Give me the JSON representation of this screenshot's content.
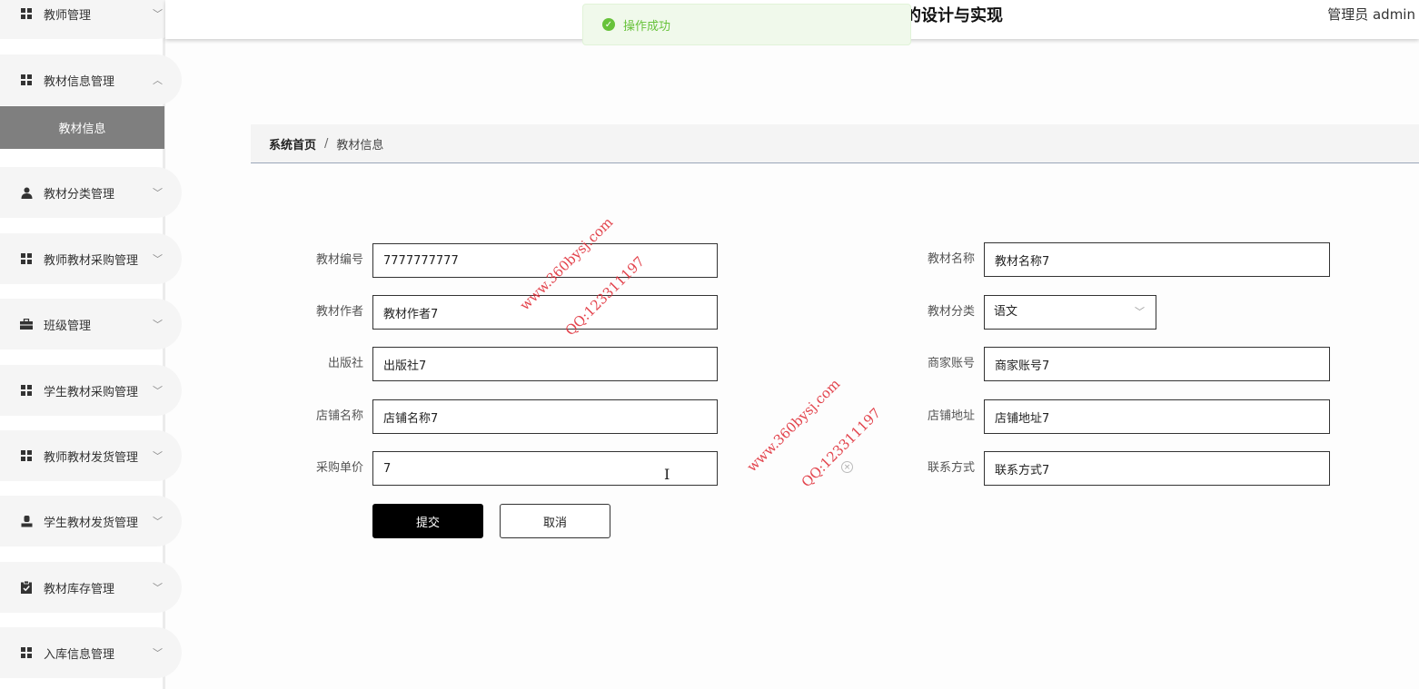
{
  "sidebar": {
    "items": [
      {
        "label": "教师管理",
        "icon": "grid-icon",
        "chevron": "﹀"
      },
      {
        "label": "教材信息管理",
        "icon": "grid-icon",
        "chevron": "︿"
      },
      {
        "label": "教材分类管理",
        "icon": "user-icon",
        "chevron": "﹀"
      },
      {
        "label": "教师教材采购管理",
        "icon": "grid-icon",
        "chevron": "﹀"
      },
      {
        "label": "班级管理",
        "icon": "briefcase-icon",
        "chevron": "﹀"
      },
      {
        "label": "学生教材采购管理",
        "icon": "grid-icon",
        "chevron": "﹀"
      },
      {
        "label": "教师教材发货管理",
        "icon": "grid-icon",
        "chevron": "﹀"
      },
      {
        "label": "学生教材发货管理",
        "icon": "person-icon",
        "chevron": "﹀"
      },
      {
        "label": "教材库存管理",
        "icon": "clipboard-check-icon",
        "chevron": "﹀"
      },
      {
        "label": "入库信息管理",
        "icon": "grid-icon",
        "chevron": "﹀"
      }
    ],
    "active_sub": "教材信息"
  },
  "header": {
    "title": "的设计与实现",
    "user": "管理员 admin"
  },
  "toast": {
    "message": "操作成功",
    "color": "#67c23a"
  },
  "breadcrumb": {
    "home": "系统首页",
    "separator": "/",
    "current": "教材信息"
  },
  "form": {
    "code": {
      "label": "教材编号",
      "value": "7777777777"
    },
    "name": {
      "label": "教材名称",
      "value": "教材名称7"
    },
    "author": {
      "label": "教材作者",
      "value": "教材作者7"
    },
    "category": {
      "label": "教材分类",
      "value": "语文"
    },
    "publisher": {
      "label": "出版社",
      "value": "出版社7"
    },
    "merchant_account": {
      "label": "商家账号",
      "value": "商家账号7"
    },
    "shop_name": {
      "label": "店铺名称",
      "value": "店铺名称7"
    },
    "shop_address": {
      "label": "店铺地址",
      "value": "店铺地址7"
    },
    "unit_price": {
      "label": "采购单价",
      "value": "7"
    },
    "contact": {
      "label": "联系方式",
      "value": "联系方式7"
    },
    "submit_label": "提交",
    "cancel_label": "取消"
  },
  "watermarks": {
    "site": "www.360bysj.com",
    "qq": "QQ:123311197"
  }
}
